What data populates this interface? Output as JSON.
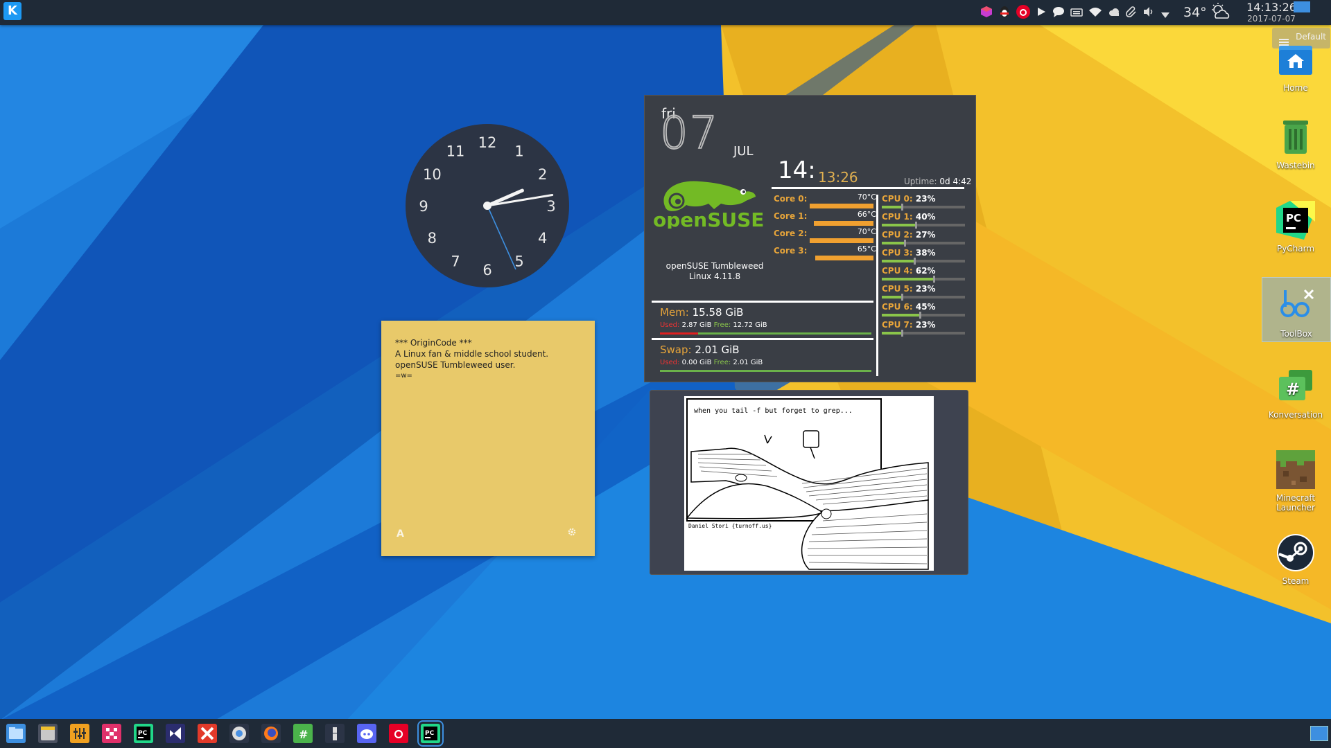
{
  "panel": {
    "tray_icons": [
      "cube-icon",
      "qq-icon",
      "netease-music-icon",
      "play-icon",
      "chat-icon",
      "keyboard-icon",
      "wifi-icon",
      "cloud-icon",
      "paperclip-icon",
      "volume-icon",
      "expand-arrow-icon"
    ],
    "weather_temp": "34°",
    "weather_icon": "partly-cloudy-icon",
    "time": "14:13:26",
    "date": "2017-07-07"
  },
  "toolbox": {
    "label": "Default"
  },
  "desktop_icons": [
    {
      "label": "Home",
      "icon": "home-folder-icon"
    },
    {
      "label": "Wastebin",
      "icon": "trash-icon"
    },
    {
      "label": "PyCharm",
      "icon": "pycharm-icon"
    },
    {
      "label": "ToolBox",
      "icon": "toolbox-icon"
    },
    {
      "label": "Konversation",
      "icon": "konversation-icon"
    },
    {
      "label": "Minecraft Launcher",
      "label_l1": "Minecraft",
      "label_l2": "Launcher",
      "icon": "minecraft-icon"
    },
    {
      "label": "Steam",
      "icon": "steam-icon"
    }
  ],
  "clock": {
    "numerals": [
      "12",
      "1",
      "2",
      "3",
      "4",
      "5",
      "6",
      "7",
      "8",
      "9",
      "10",
      "11"
    ],
    "hours": 2,
    "minutes": 13,
    "seconds": 26
  },
  "note": {
    "line1": "*** OriginCode ***",
    "line2": "A Linux fan & middle school student.",
    "line3": "openSUSE Tumbleweed user.",
    "line4": "=w=",
    "format_glyph": "A"
  },
  "conky": {
    "weekday": "fri",
    "day": "07",
    "month": "JUL",
    "hour": "14:",
    "minsec": "13:26",
    "uptime_label": "Uptime:",
    "uptime_value": "0d 4:42",
    "logo_text": "openSUSE",
    "os_name": "openSUSE Tumbleweed",
    "kernel": "Linux 4.11.8",
    "cores": [
      {
        "label": "Core 0:",
        "temp": "70°C",
        "level": 0.92
      },
      {
        "label": "Core 1:",
        "temp": "66°C",
        "level": 0.86
      },
      {
        "label": "Core 2:",
        "temp": "70°C",
        "level": 0.92
      },
      {
        "label": "Core 3:",
        "temp": "65°C",
        "level": 0.84
      }
    ],
    "cpus": [
      {
        "label": "CPU 0:",
        "value": "23%",
        "level": 0.23
      },
      {
        "label": "CPU 1:",
        "value": "40%",
        "level": 0.4
      },
      {
        "label": "CPU 2:",
        "value": "27%",
        "level": 0.27
      },
      {
        "label": "CPU 3:",
        "value": "38%",
        "level": 0.38
      },
      {
        "label": "CPU 4:",
        "value": "62%",
        "level": 0.62
      },
      {
        "label": "CPU 5:",
        "value": "23%",
        "level": 0.23
      },
      {
        "label": "CPU 6:",
        "value": "45%",
        "level": 0.45
      },
      {
        "label": "CPU 7:",
        "value": "23%",
        "level": 0.23
      }
    ],
    "mem": {
      "label": "Mem:",
      "total": "15.58 GiB",
      "used_label": "Used:",
      "used": "2.87 GiB",
      "free_label": "Free:",
      "free": "12.72 GiB",
      "used_level": 0.18
    },
    "swap": {
      "label": "Swap:",
      "total": "2.01 GiB",
      "used_label": "Used:",
      "used": "0.00 GiB",
      "free_label": "Free:",
      "free": "2.01 GiB",
      "used_level": 0.0
    }
  },
  "comic": {
    "caption": "when you tail -f but forget to grep...",
    "credit": "Daniel Stori {turnoff.us}"
  },
  "taskbar": {
    "apps": [
      "dolphin-icon",
      "file-manager-icon",
      "mixer-icon",
      "pixel-app-icon",
      "pycharm-icon",
      "visual-studio-code-icon",
      "xmind-icon",
      "chromium-icon",
      "firefox-icon",
      "konversation-icon",
      "app-icon",
      "discord-icon",
      "netease-music-icon",
      "pycharm-running-icon"
    ]
  },
  "colors": {
    "accent": "#1d99f3",
    "conky_orange": "#e6a43a",
    "conky_green": "#8ac54a",
    "note_yellow": "#e8c96a"
  }
}
